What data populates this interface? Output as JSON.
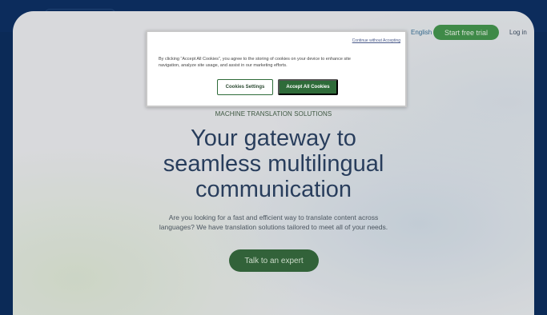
{
  "header": {
    "language": "English",
    "trial_button": "Start free trial",
    "login": "Log in"
  },
  "hero": {
    "eyebrow": "MACHINE TRANSLATION SOLUTIONS",
    "headline_line1": "Your gateway to",
    "headline_line2": "seamless multilingual",
    "headline_line3": "communication",
    "subtext_line1": "Are you looking for a fast and efficient way to translate content across",
    "subtext_line2": "languages? We have translation solutions tailored to meet all of your needs.",
    "cta": "Talk to an expert"
  },
  "cookie_modal": {
    "close_link": "Continue without Accepting",
    "body_line1": "By clicking “Accept All Cookies”, you agree to the storing of cookies on your device to enhance site",
    "body_line2": "navigation, analyze site usage, and assist in our marketing efforts.",
    "settings_button": "Cookies Settings",
    "accept_button": "Accept All Cookies"
  },
  "colors": {
    "brand_navy": "#0c2c5c",
    "brand_green": "#2f8a3a",
    "cta_green": "#1f5a28"
  }
}
